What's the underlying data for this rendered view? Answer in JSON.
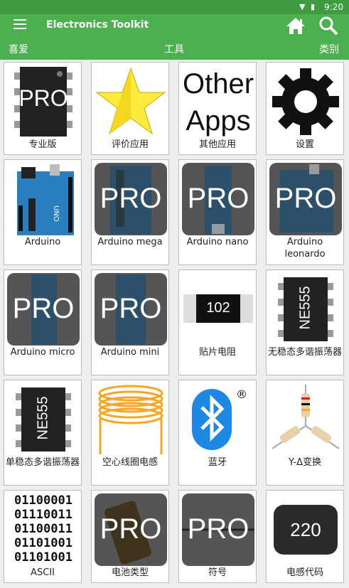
{
  "status": {
    "time": "9:20",
    "icons": "▼ ▮"
  },
  "app": {
    "title": "Electronics Toolkit"
  },
  "tabs": [
    "喜爱",
    "工具",
    "类别"
  ],
  "items": [
    {
      "label": "专业版",
      "badge": "PRO"
    },
    {
      "label": "评价应用"
    },
    {
      "label": "其他应用",
      "text1": "Other",
      "text2": "Apps"
    },
    {
      "label": "设置"
    },
    {
      "label": "Arduino"
    },
    {
      "label": "Arduino mega",
      "badge": "PRO"
    },
    {
      "label": "Arduino nano",
      "badge": "PRO"
    },
    {
      "label": "Arduino leonardo",
      "badge": "PRO"
    },
    {
      "label": "Arduino micro",
      "badge": "PRO"
    },
    {
      "label": "Arduino mini",
      "badge": "PRO"
    },
    {
      "label": "贴片电阻",
      "code": "102"
    },
    {
      "label": "无稳态多谐振荡器",
      "chip": "NE555"
    },
    {
      "label": "单稳态多谐振荡器",
      "chip": "NE555"
    },
    {
      "label": "空心线圈电感"
    },
    {
      "label": "蓝牙",
      "mark": "®"
    },
    {
      "label": "Y-Δ变换"
    },
    {
      "label": "ASCII",
      "lines": [
        "01100001",
        "01110011",
        "01100011",
        "01101001",
        "01101001"
      ]
    },
    {
      "label": "电池类型",
      "badge": "PRO"
    },
    {
      "label": "符号",
      "badge": "PRO"
    },
    {
      "label": "电感代码",
      "code": "220"
    }
  ]
}
